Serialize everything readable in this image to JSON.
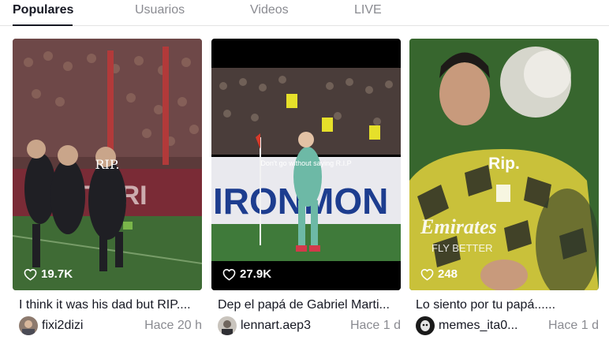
{
  "tabs": [
    {
      "label": "Populares",
      "active": true
    },
    {
      "label": "Usuarios",
      "active": false
    },
    {
      "label": "Videos",
      "active": false
    },
    {
      "label": "LIVE",
      "active": false
    }
  ],
  "icons": {
    "like": "heart-outline-icon"
  },
  "colors": {
    "text": "#161823",
    "muted": "#8a8b91",
    "divider": "#e3e3e4"
  },
  "videos": [
    {
      "overlay_text": "RIP.",
      "likes": "19.7K",
      "caption": "I think it was his dad but RIP....",
      "username": "fixi2dizi",
      "time_ago": "Hace 20 h"
    },
    {
      "overlay_text": "Don't go without saying R.I.P",
      "likes": "27.9K",
      "caption": "Dep el papá de Gabriel Marti...",
      "username": "lennart.aep3",
      "time_ago": "Hace 1 d"
    },
    {
      "overlay_text": "Rip.",
      "likes": "248",
      "caption": "Lo siento por tu papá......",
      "username": "memes_ita0...",
      "time_ago": "Hace 1 d"
    }
  ]
}
